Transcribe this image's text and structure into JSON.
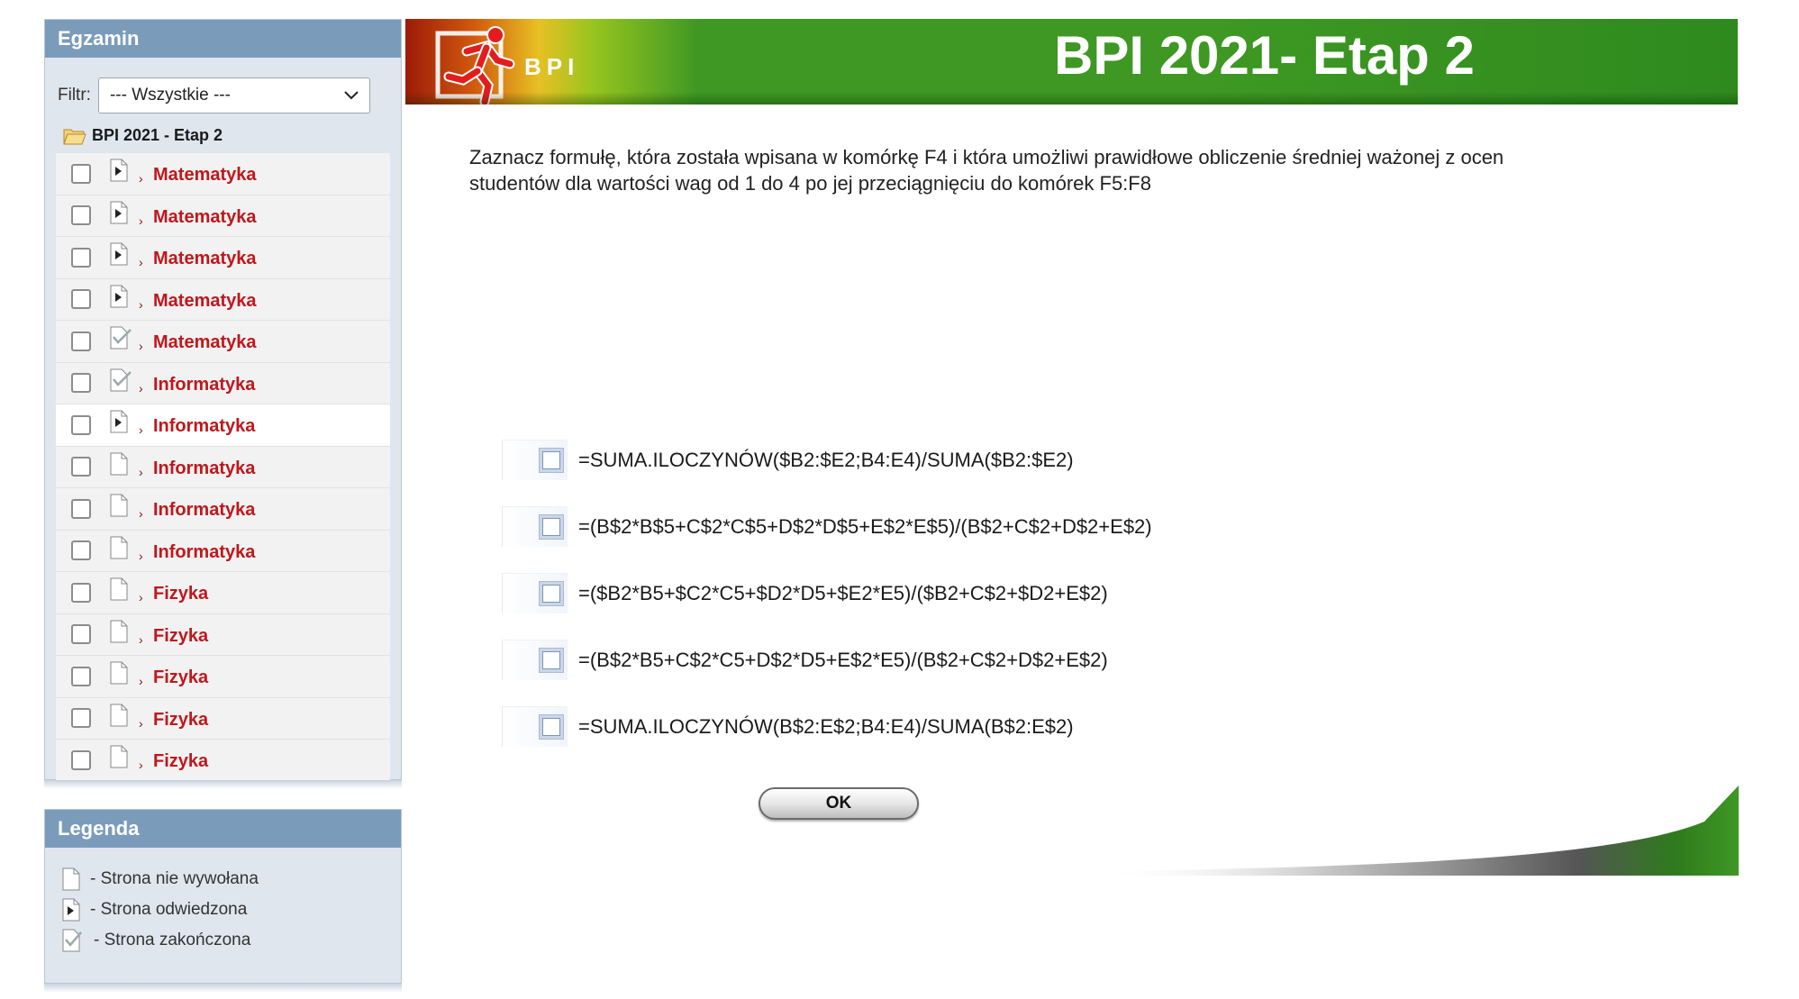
{
  "sidebar": {
    "title": "Egzamin",
    "filter_label": "Filtr:",
    "filter_value": "--- Wszystkie ---",
    "root_label": "BPI 2021 - Etap 2",
    "items": [
      {
        "label": "Matematyka",
        "status": "visited"
      },
      {
        "label": "Matematyka",
        "status": "visited"
      },
      {
        "label": "Matematyka",
        "status": "visited"
      },
      {
        "label": "Matematyka",
        "status": "visited"
      },
      {
        "label": "Matematyka",
        "status": "completed"
      },
      {
        "label": "Informatyka",
        "status": "completed"
      },
      {
        "label": "Informatyka",
        "status": "visited"
      },
      {
        "label": "Informatyka",
        "status": "not-called"
      },
      {
        "label": "Informatyka",
        "status": "not-called"
      },
      {
        "label": "Informatyka",
        "status": "not-called"
      },
      {
        "label": "Fizyka",
        "status": "not-called"
      },
      {
        "label": "Fizyka",
        "status": "not-called"
      },
      {
        "label": "Fizyka",
        "status": "not-called"
      },
      {
        "label": "Fizyka",
        "status": "not-called"
      },
      {
        "label": "Fizyka",
        "status": "not-called"
      }
    ],
    "active_index": 6
  },
  "legend": {
    "title": "Legenda",
    "items": [
      {
        "label": "- Strona nie wywołana",
        "icon": "page-not-called-icon"
      },
      {
        "label": "- Strona odwiedzona",
        "icon": "page-visited-icon"
      },
      {
        "label": "- Strona zakończona",
        "icon": "page-completed-icon"
      }
    ]
  },
  "banner": {
    "title": "BPI 2021- Etap 2",
    "logo_text": "BPI"
  },
  "question": {
    "line1": "Zaznacz formułę, która została wpisana w komórkę F4 i która umożliwi prawidłowe obliczenie średniej ważonej z ocen",
    "line2": "studentów dla wartości wag od 1 do 4 po jej przeciągnięciu do komórek F5:F8"
  },
  "answers": [
    "=SUMA.ILOCZYNÓW($B2:$E2;B4:E4)/SUMA($B2:$E2)",
    "=(B$2*B$5+C$2*C$5+D$2*D$5+E$2*E$5)/(B$2+C$2+D$2+E$2)",
    "=($B2*B5+$C2*C5+$D2*D5+$E2*E5)/($B2+C$2+$D2+E$2)",
    "=(B$2*B5+C$2*C5+D$2*D5+E$2*E5)/(B$2+C$2+D$2+E$2)",
    "=SUMA.ILOCZYNÓW(B$2:E$2;B4:E4)/SUMA(B$2:E$2)"
  ],
  "ok_label": "OK",
  "colors": {
    "panel_header": "#7b9bbb",
    "item_label": "#c0171c",
    "banner_green": "#3e9823"
  }
}
